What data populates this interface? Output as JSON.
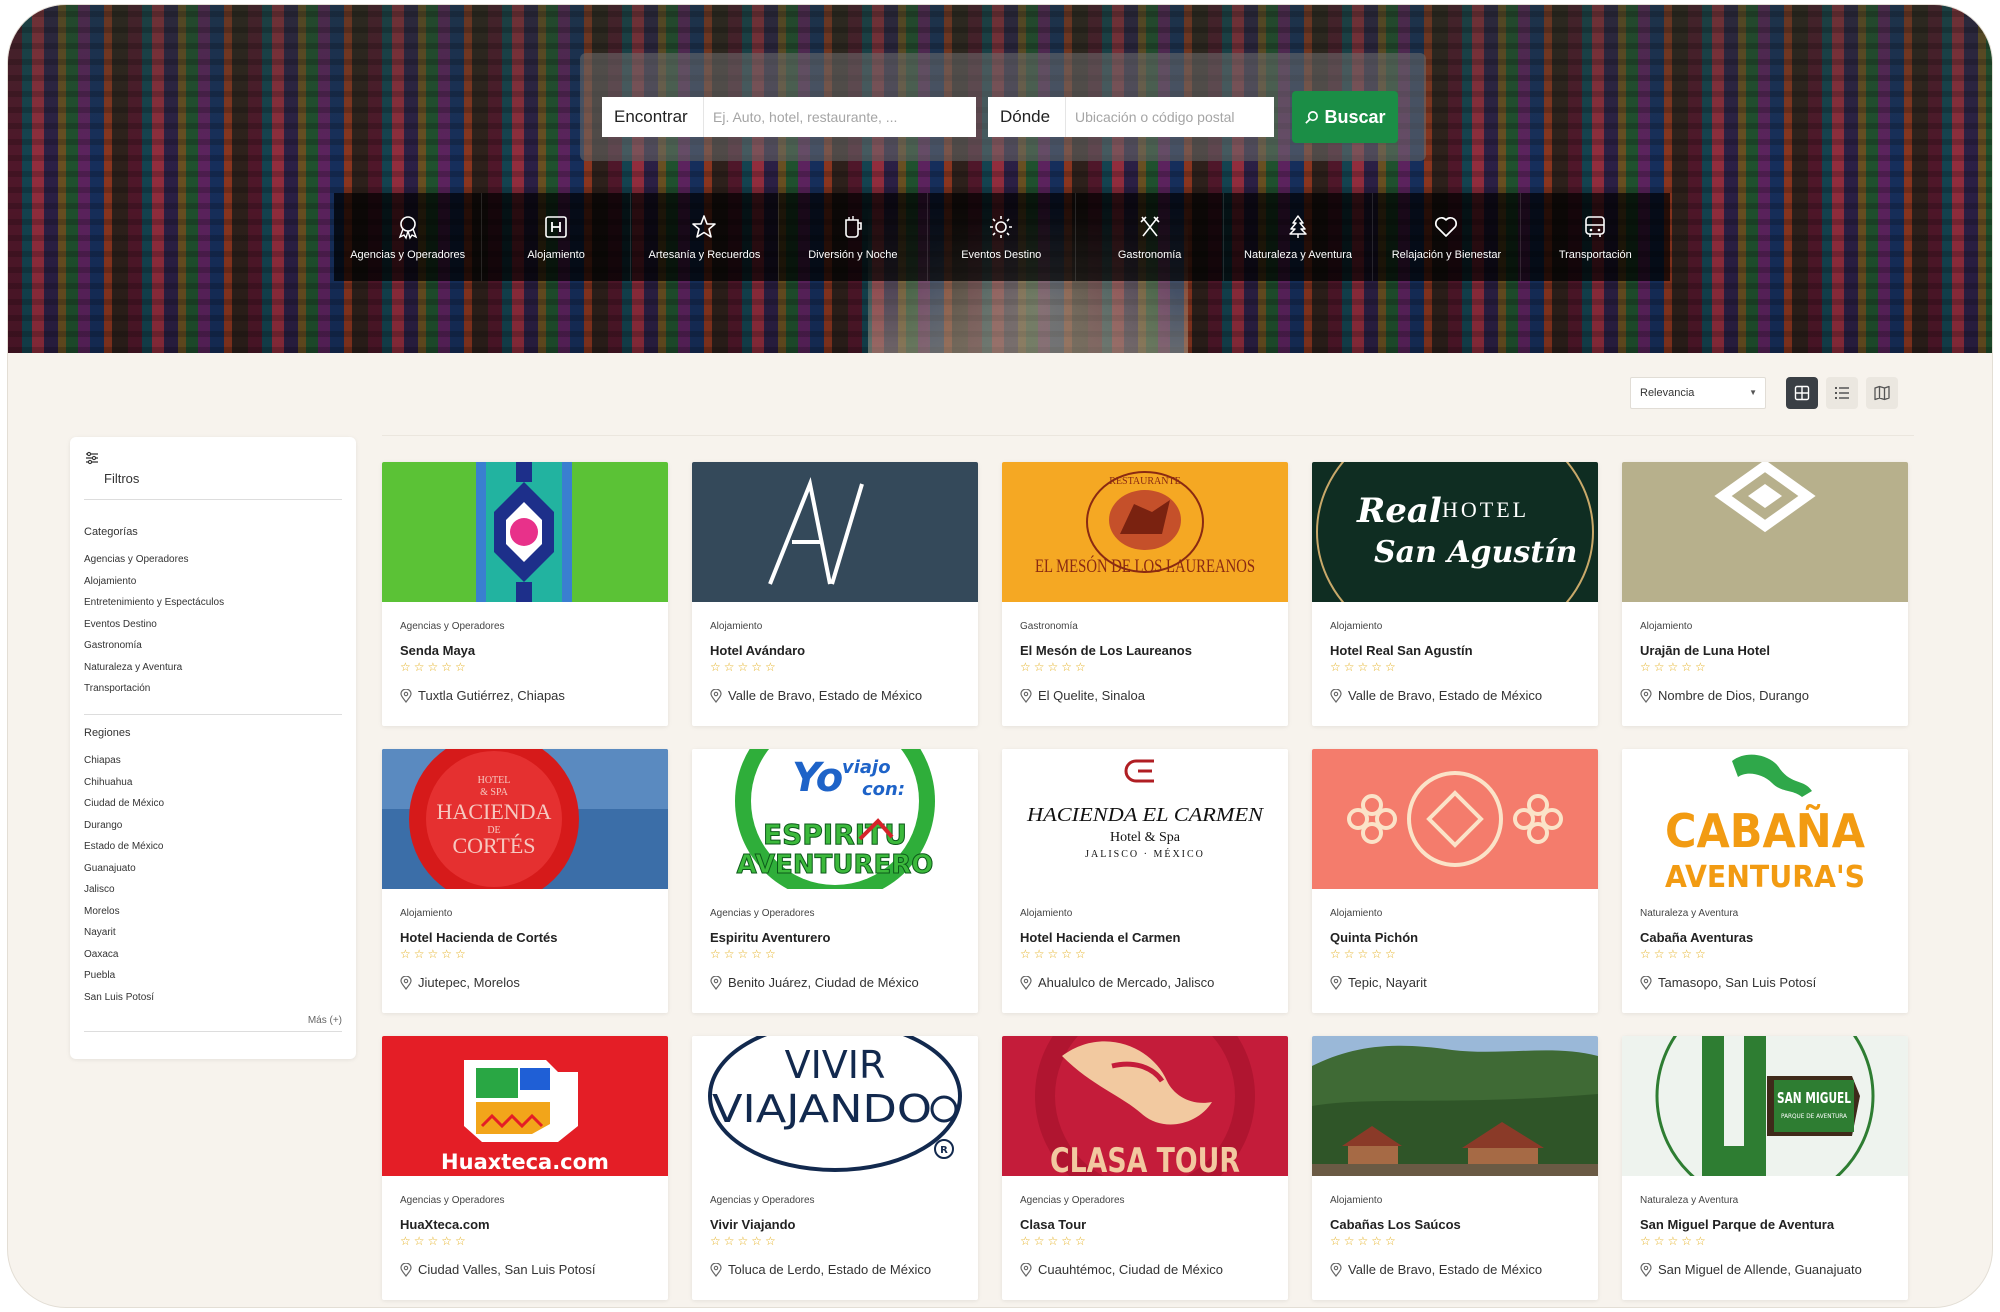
{
  "search": {
    "find_label": "Encontrar",
    "find_placeholder": "Ej. Auto, hotel, restaurante, ...",
    "where_label": "Dónde",
    "where_placeholder": "Ubicación o código postal",
    "button_label": "Buscar"
  },
  "categories_bar": [
    {
      "label": "Agencias y Operadores",
      "icon": "ribbon-award-icon"
    },
    {
      "label": "Alojamiento",
      "icon": "hotel-h-icon"
    },
    {
      "label": "Artesanía y Recuerdos",
      "icon": "star-icon"
    },
    {
      "label": "Diversión y Noche",
      "icon": "drink-cup-icon"
    },
    {
      "label": "Eventos Destino",
      "icon": "sun-icon"
    },
    {
      "label": "Gastronomía",
      "icon": "fork-knife-icon"
    },
    {
      "label": "Naturaleza y Aventura",
      "icon": "tree-icon"
    },
    {
      "label": "Relajación y Bienestar",
      "icon": "heart-icon"
    },
    {
      "label": "Transportación",
      "icon": "bus-icon"
    }
  ],
  "toolbar": {
    "sort_value": "Relevancia",
    "views": [
      "grid-view-icon",
      "list-view-icon",
      "map-view-icon"
    ],
    "active_view": "grid"
  },
  "sidebar": {
    "title": "Filtros",
    "categories_heading": "Categorías",
    "categories": [
      "Agencias y Operadores",
      "Alojamiento",
      "Entretenimiento y Espectáculos",
      "Eventos Destino",
      "Gastronomía",
      "Naturaleza y Aventura",
      "Transportación"
    ],
    "regions_heading": "Regiones",
    "regions": [
      "Chiapas",
      "Chihuahua",
      "Ciudad de México",
      "Durango",
      "Estado de México",
      "Guanajuato",
      "Jalisco",
      "Morelos",
      "Nayarit",
      "Oaxaca",
      "Puebla",
      "San Luis Potosí"
    ],
    "more_label": "Más (+)"
  },
  "listings": [
    {
      "category": "Agencias y Operadores",
      "name": "Senda Maya",
      "location": "Tuxtla Gutiérrez, Chiapas",
      "stars": "☆☆☆☆☆",
      "image_bg": "#5bc236"
    },
    {
      "category": "Alojamiento",
      "name": "Hotel Avándaro",
      "location": "Valle de Bravo, Estado de México",
      "stars": "☆☆☆☆☆",
      "image_bg": "#34495a"
    },
    {
      "category": "Gastronomía",
      "name": "El Mesón de Los Laureanos",
      "location": "El Quelite, Sinaloa",
      "stars": "☆☆☆☆☆",
      "image_bg": "#f5a823"
    },
    {
      "category": "Alojamiento",
      "name": "Hotel Real San Agustín",
      "location": "Valle de Bravo, Estado de México",
      "stars": "☆☆☆☆☆",
      "image_bg": "#0f2d22"
    },
    {
      "category": "Alojamiento",
      "name": "Urajān de Luna Hotel",
      "location": "Nombre de Dios, Durango",
      "stars": "☆☆☆☆☆",
      "image_bg": "#b7b08c"
    },
    {
      "category": "Alojamiento",
      "name": "Hotel Hacienda de Cortés",
      "location": "Jiutepec, Morelos",
      "stars": "☆☆☆☆☆",
      "image_bg": "#3b6ea8"
    },
    {
      "category": "Agencias y Operadores",
      "name": "Espiritu Aventurero",
      "location": "Benito Juárez, Ciudad de México",
      "stars": "☆☆☆☆☆",
      "image_bg": "#ffffff"
    },
    {
      "category": "Alojamiento",
      "name": "Hotel Hacienda el Carmen",
      "location": "Ahualulco de Mercado, Jalisco",
      "stars": "☆☆☆☆☆",
      "image_bg": "#ffffff"
    },
    {
      "category": "Alojamiento",
      "name": "Quinta Pichón",
      "location": "Tepic, Nayarit",
      "stars": "☆☆☆☆☆",
      "image_bg": "#f47c6c"
    },
    {
      "category": "Naturaleza y Aventura",
      "name": "Cabaña Aventuras",
      "location": "Tamasopo, San Luis Potosí",
      "stars": "☆☆☆☆☆",
      "image_bg": "#ffffff"
    },
    {
      "category": "Agencias y Operadores",
      "name": "HuaXteca.com",
      "location": "Ciudad Valles, San Luis Potosí",
      "stars": "☆☆☆☆☆",
      "image_bg": "#e41e26"
    },
    {
      "category": "Agencias y Operadores",
      "name": "Vivir Viajando",
      "location": "Toluca de Lerdo, Estado de México",
      "stars": "☆☆☆☆☆",
      "image_bg": "#ffffff"
    },
    {
      "category": "Agencias y Operadores",
      "name": "Clasa Tour",
      "location": "Cuauhtémoc, Ciudad de México",
      "stars": "☆☆☆☆☆",
      "image_bg": "#c41c3a"
    },
    {
      "category": "Alojamiento",
      "name": "Cabañas Los Saúcos",
      "location": "Valle de Bravo, Estado de México",
      "stars": "☆☆☆☆☆",
      "image_bg": "#4f7a3e"
    },
    {
      "category": "Naturaleza y Aventura",
      "name": "San Miguel Parque de Aventura",
      "location": "San Miguel de Allende, Guanajuato",
      "stars": "☆☆☆☆☆",
      "image_bg": "#eef3ee"
    }
  ],
  "logo_texts": {
    "avandaro": "A/",
    "meson_top": "RESTAURANTE",
    "meson_main": "EL MESÓN DE LOS LAUREANOS",
    "real_1": "Real",
    "real_2": "HOTEL",
    "real_3": "San Agustín",
    "cortes_1": "HOTEL",
    "cortes_2": "& SPA",
    "cortes_3": "HACIENDA",
    "cortes_4": "DE",
    "cortes_5": "CORTÉS",
    "espiritu_1": "Yo",
    "espiritu_2": "viajo",
    "espiritu_3": "con:",
    "espiritu_4": "ESPIRITU",
    "espiritu_5": "AVENTURERO",
    "carmen_1": "HACIENDA EL CARMEN",
    "carmen_2": "Hotel & Spa",
    "carmen_3": "JALISCO · MÉXICO",
    "cabana_1": "CABAÑA",
    "cabana_2": "AVENTURA'S",
    "huaxteca": "Huaxteca.com",
    "vivir_1": "VIVIR",
    "vivir_2": "VIAJANDO",
    "clasa": "CLASA TOUR",
    "sanmiguel_1": "SAN MIGUEL",
    "sanmiguel_2": "PARQUE DE AVENTURA"
  },
  "colors": {
    "primary_green": "#1b8e46",
    "star_yellow": "#e4b021",
    "page_bg": "#f7f3ed"
  }
}
